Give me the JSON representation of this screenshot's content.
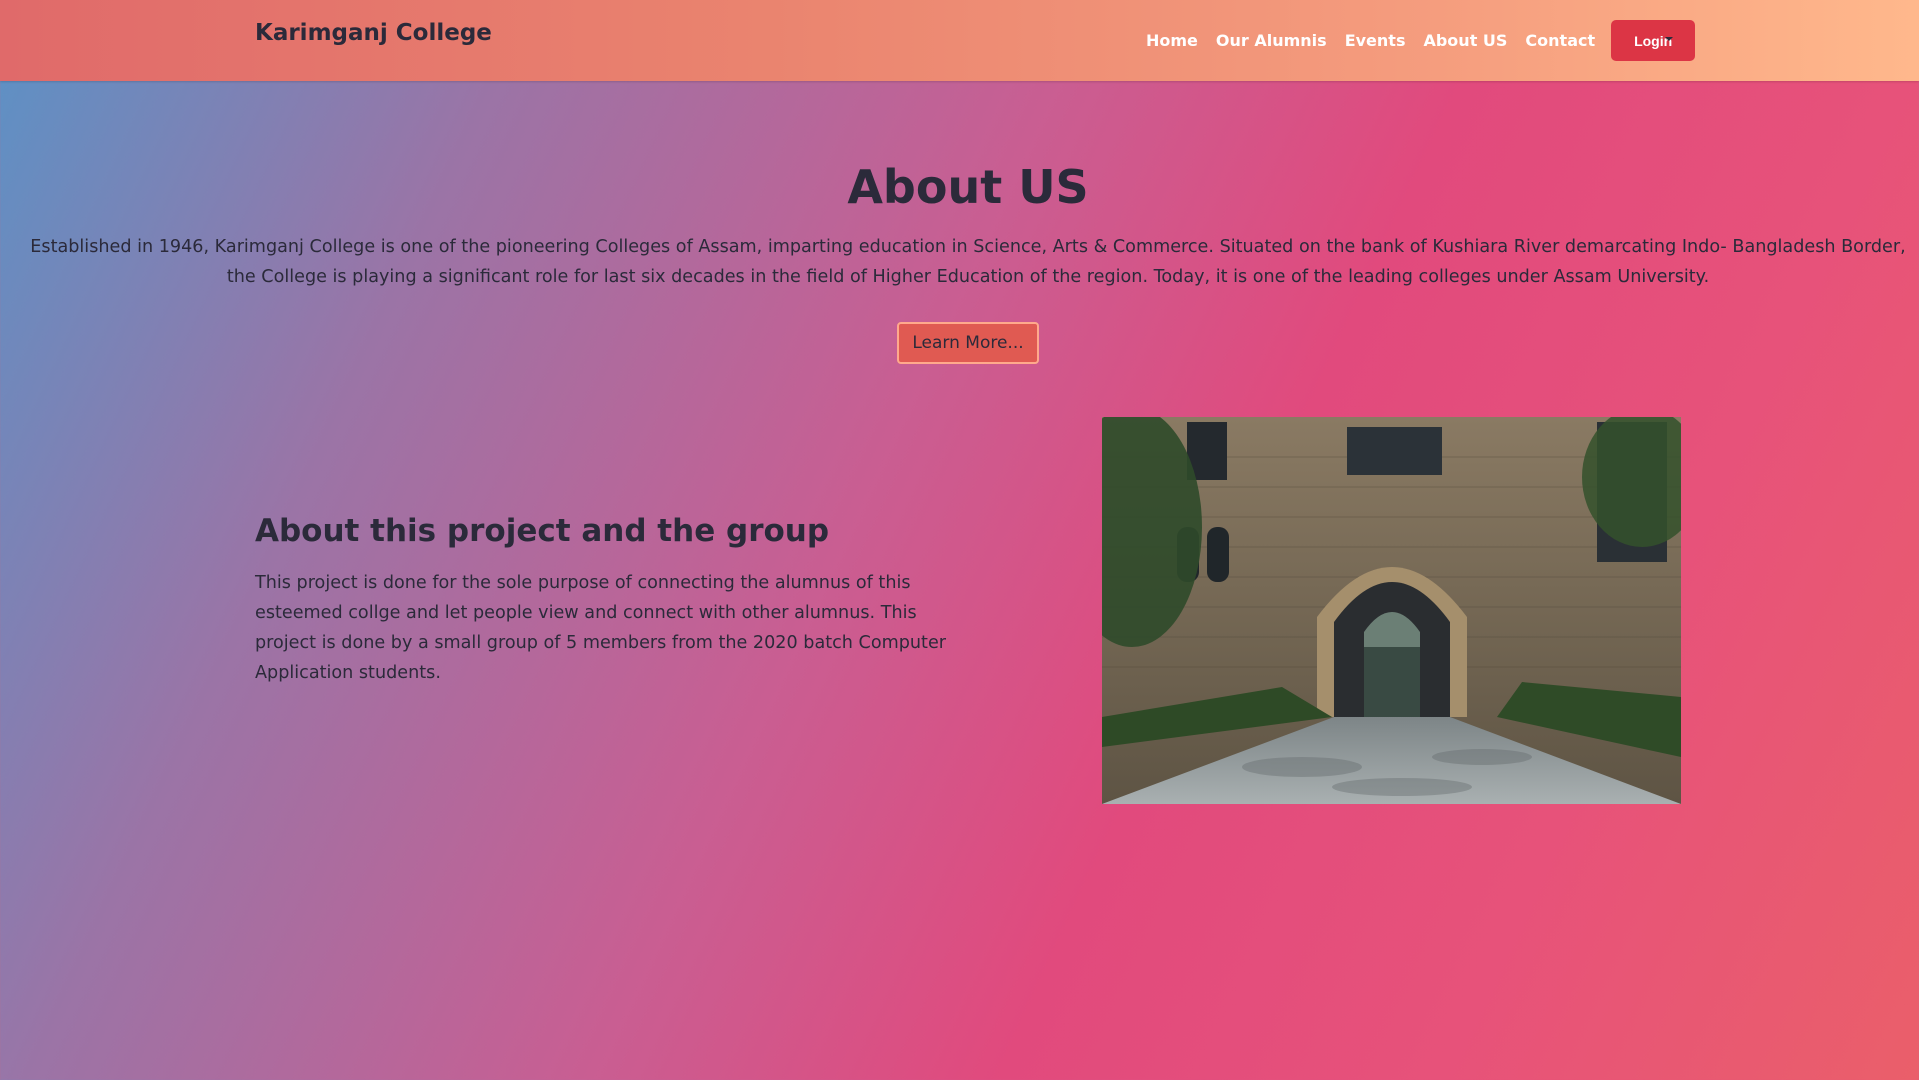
{
  "navbar": {
    "brand": "Karimganj College",
    "links": [
      "Home",
      "Our Alumnis",
      "Events",
      "About US",
      "Contact"
    ],
    "login_label": "Login",
    "dropdown_icon": "caret-down-icon"
  },
  "hero": {
    "title": "About US",
    "description": "Established in 1946, Karimganj College is one of the pioneering Colleges of Assam, imparting education in Science, Arts & Commerce. Situated on the bank of Kushiara River demarcating Indo- Bangladesh Border, the College is playing a significant role for last six decades in the field of Higher Education of the region. Today, it is one of the leading colleges under Assam University.",
    "button_label": "Learn More..."
  },
  "project": {
    "title": "About this project and the group",
    "description": "This project is done for the sole purpose of connecting the alumnus of this esteemed collge and let people view and connect with other alumnus. This project is done by a small group of 5 members from the 2020 batch Computer Application students."
  },
  "colors": {
    "navbar_start": "#e06a6a",
    "navbar_end": "#ffb88c",
    "login_button": "#dc3545",
    "learn_button": "#e05a52",
    "text_dark": "#2b2a3a"
  }
}
